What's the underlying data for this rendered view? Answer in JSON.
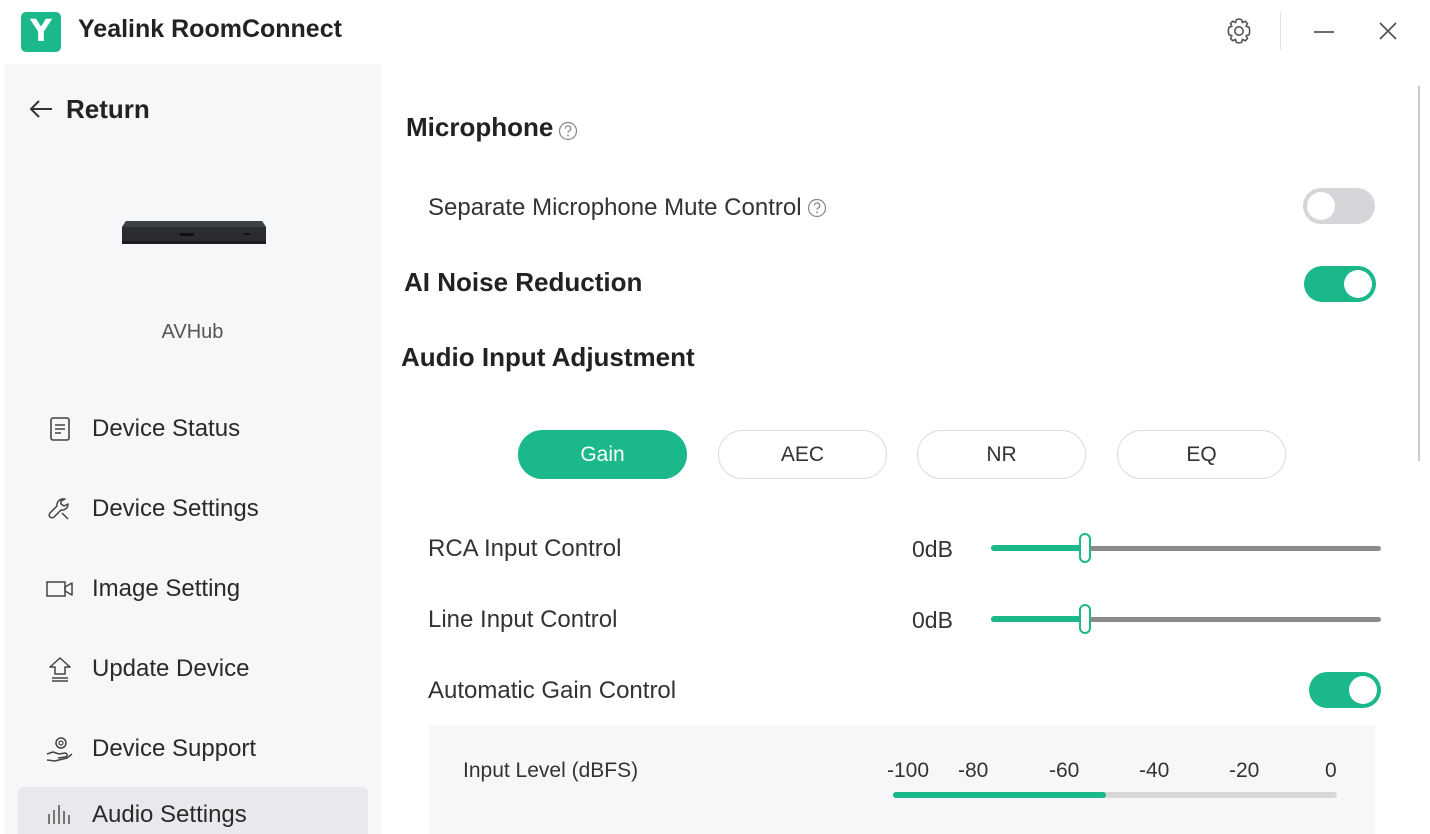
{
  "window": {
    "logo_letter": "Y",
    "title": "Yealink RoomConnect",
    "icons": {
      "settings": "gear-icon",
      "minimize": "minimize-icon",
      "close": "close-icon"
    }
  },
  "sidebar": {
    "return_label": "Return",
    "device_name": "AVHub",
    "items": [
      {
        "label": "Device Status",
        "icon": "document-icon",
        "active": false
      },
      {
        "label": "Device Settings",
        "icon": "wrench-icon",
        "active": false
      },
      {
        "label": "Image Setting",
        "icon": "camera-icon",
        "active": false
      },
      {
        "label": "Update Device",
        "icon": "upload-icon",
        "active": false
      },
      {
        "label": "Device Support",
        "icon": "support-hand-icon",
        "active": false
      },
      {
        "label": "Audio Settings",
        "icon": "audio-bars-icon",
        "active": true
      }
    ]
  },
  "main": {
    "microphone_title": "Microphone",
    "separate_mute": {
      "label": "Separate Microphone Mute Control",
      "enabled": false
    },
    "ai_noise": {
      "label": "AI Noise Reduction",
      "enabled": true
    },
    "audio_input_title": "Audio Input Adjustment",
    "tabs": [
      {
        "label": "Gain",
        "active": true
      },
      {
        "label": "AEC",
        "active": false
      },
      {
        "label": "NR",
        "active": false
      },
      {
        "label": "EQ",
        "active": false
      }
    ],
    "rca": {
      "label": "RCA Input Control",
      "value": "0dB",
      "level": 0.24
    },
    "line": {
      "label": "Line Input Control",
      "value": "0dB",
      "level": 0.24
    },
    "agc": {
      "label": "Automatic Gain Control",
      "enabled": true
    },
    "input_level": {
      "label": "Input Level (dBFS)",
      "ticks": [
        "-100",
        "-80",
        "-60",
        "-40",
        "-20",
        "0"
      ],
      "level": 0.48
    }
  },
  "colors": {
    "accent": "#1ab88a",
    "toggle_off": "#d4d6d9",
    "sidebar_bg": "#f6f7f8"
  }
}
